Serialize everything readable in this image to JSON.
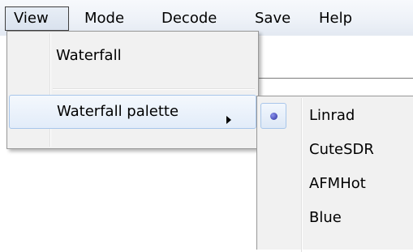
{
  "menubar": {
    "items": [
      "View",
      "Mode",
      "Decode",
      "Save",
      "Help"
    ],
    "active": "View"
  },
  "view_menu": {
    "items": [
      {
        "label": "Waterfall"
      },
      {
        "label": "Waterfall palette",
        "has_submenu": true,
        "highlighted": true
      }
    ]
  },
  "palette_submenu": {
    "items": [
      {
        "label": "Linrad",
        "selected": true
      },
      {
        "label": "CuteSDR"
      },
      {
        "label": "AFMHot"
      },
      {
        "label": "Blue"
      }
    ]
  },
  "icons": {
    "submenu_arrow": "triangle-right-icon",
    "radio_selected": "radio-dot-icon"
  },
  "colors": {
    "highlight_border": "#a8c6ea",
    "radio_dot": "#3a3fb0"
  }
}
